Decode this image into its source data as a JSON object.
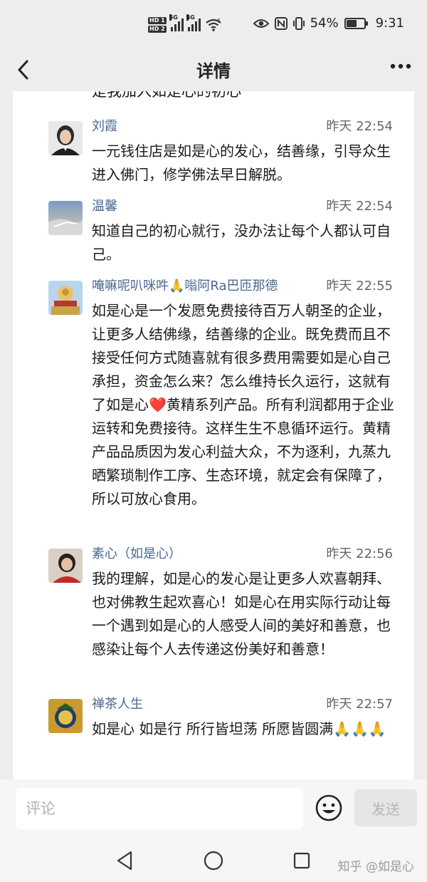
{
  "status_bar": {
    "sim1": "HD 1",
    "sim2": "HD 2",
    "net1": "5G",
    "net2": "4G",
    "wifi_badge": "6",
    "battery_percent": "54%",
    "battery_level": 0.54,
    "time": "9:31"
  },
  "nav": {
    "back_glyph": "‹",
    "title": "详情",
    "more_glyph": "•••"
  },
  "top_cut_text": "是我加入如是心的初心",
  "comments": [
    {
      "name": "刘霞",
      "time": "昨天 22:54",
      "text": "一元钱住店是如是心的发心，结善缘，引导众生进入佛门，修学佛法早日解脱。",
      "avatar": "avatar-portrait"
    },
    {
      "name": "温馨",
      "time": "昨天 22:54",
      "text": "知道自己的初心就行，没办法让每个人都认可自己。",
      "avatar": "avatar-sky"
    },
    {
      "name": "唵嘛呢叭咪吽🙏嗡阿Ra巴匝那德",
      "time": "昨天 22:55",
      "text": "如是心是一个发愿免费接待百万人朝圣的企业，让更多人结佛缘，结善缘的企业。既免费而且不接受任何方式随喜就有很多费用需要如是心自己承担，资金怎么来？怎么维持长久运行，这就有了如是心❤️黄精系列产品。所有利润都用于企业运转和免费接待。这样生生不息循环运行。黄精产品品质因为发心利益大众，不为逐利，九蒸九晒繁琐制作工序、生态环境，就定会有保障了，所以可放心食用。",
      "avatar": "avatar-temple"
    },
    {
      "name": "素心（如是心）",
      "time": "昨天 22:56",
      "text": "我的理解，如是心的发心是让更多人欢喜朝拜、也对佛教生起欢喜心！如是心在用实际行动让每一个遇到如是心的人感受人间的美好和善意，也感染让每个人去传递这份美好和善意！",
      "avatar": "avatar-woman"
    },
    {
      "name": "禅茶人生",
      "time": "昨天 22:57",
      "text": "如是心 如是行 所行皆坦荡 所愿皆圆满🙏🙏🙏",
      "avatar": "avatar-logo"
    }
  ],
  "input_bar": {
    "placeholder": "评论",
    "send_label": "发送"
  },
  "watermark": "知乎 @如是心",
  "colors": {
    "name_blue": "#4a6890",
    "background": "#ededed"
  }
}
